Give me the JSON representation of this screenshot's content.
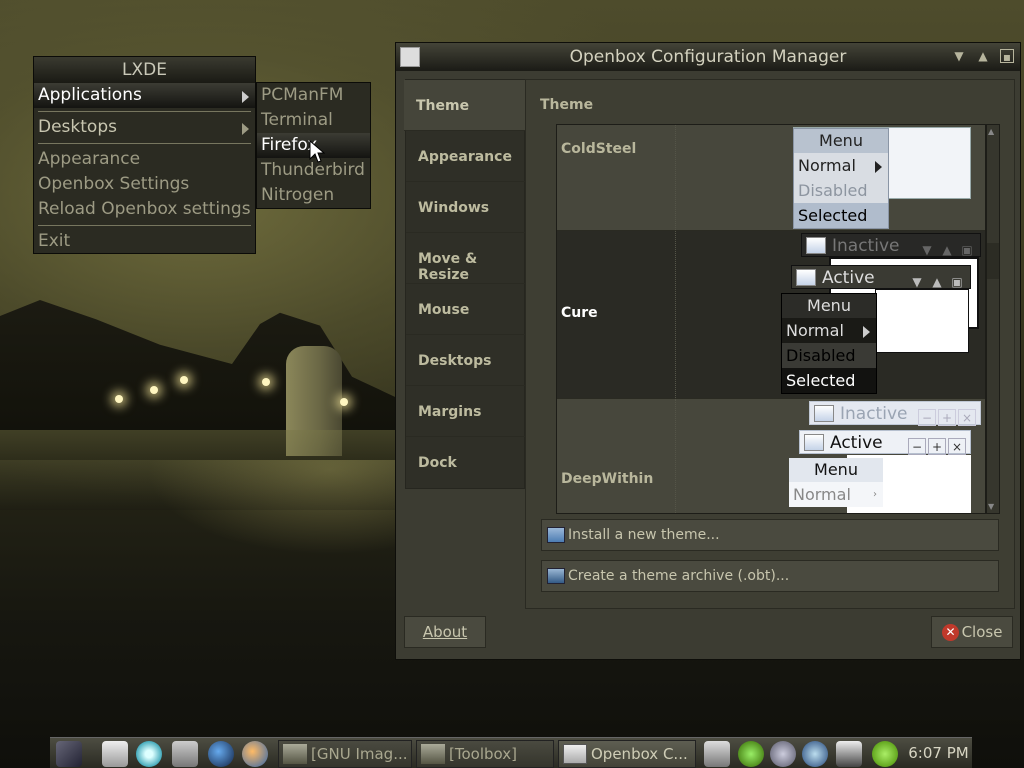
{
  "lxde_menu": {
    "header": "LXDE",
    "items": [
      "Applications",
      "Desktops",
      "Appearance",
      "Openbox Settings",
      "Reload Openbox settings",
      "Exit"
    ]
  },
  "submenu": {
    "items": [
      "PCManFM",
      "Terminal",
      "Firefox",
      "Thunderbird",
      "Nitrogen"
    ]
  },
  "window": {
    "title": "Openbox Configuration Manager",
    "sidebar": [
      "Theme",
      "Appearance",
      "Windows",
      "Move & Resize",
      "Mouse",
      "Desktops",
      "Margins",
      "Dock"
    ],
    "panel_title": "Theme",
    "themes": [
      "ColdSteel",
      "Cure",
      "DeepWithin"
    ],
    "install_button": "Install a new theme...",
    "archive_button": "Create a theme archive (.obt)...",
    "about_button": "About",
    "close_button": "Close"
  },
  "preview": {
    "menu": "Menu",
    "normal": "Normal",
    "disabled": "Disabled",
    "selected": "Selected",
    "inactive": "Inactive",
    "active": "Active"
  },
  "taskbar": {
    "tasks": [
      "[GNU Imag...",
      "[Toolbox]",
      "Openbox C..."
    ],
    "clock": "6:07 PM"
  },
  "colors": {
    "accent": "#3c3c32",
    "menu_bg": "#2b2b22",
    "close_icon": "#c0392b"
  }
}
